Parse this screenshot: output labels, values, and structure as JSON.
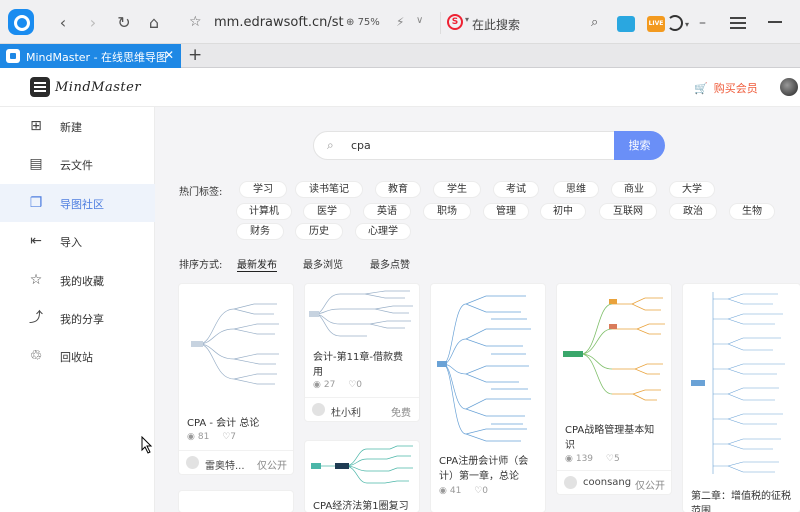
{
  "browser": {
    "url": "mm.edrawsoft.cn/st",
    "zoom": "75%",
    "search_placeholder": "在此搜索",
    "ext2_label": "LIVE"
  },
  "tab": {
    "title": "MindMaster - 在线思维导图"
  },
  "app": {
    "name": "MindMaster",
    "buy_label": "购买会员"
  },
  "sidebar": {
    "items": [
      {
        "label": "新建",
        "icon": "plus-square-icon"
      },
      {
        "label": "云文件",
        "icon": "cloud-file-icon"
      },
      {
        "label": "导图社区",
        "icon": "community-icon"
      },
      {
        "label": "导入",
        "icon": "import-icon"
      },
      {
        "label": "我的收藏",
        "icon": "star-icon"
      },
      {
        "label": "我的分享",
        "icon": "share-icon"
      },
      {
        "label": "回收站",
        "icon": "trash-icon"
      }
    ]
  },
  "search": {
    "query": "cpa",
    "button": "搜索"
  },
  "hot": {
    "label": "热门标签:",
    "tags": [
      "学习",
      "读书笔记",
      "教育",
      "学生",
      "考试",
      "思维",
      "商业",
      "大学",
      "计算机",
      "医学",
      "英语",
      "职场",
      "管理",
      "初中",
      "互联网",
      "政治",
      "生物",
      "财务",
      "历史",
      "心理学"
    ]
  },
  "sort": {
    "label": "排序方式:",
    "options": [
      "最新发布",
      "最多浏览",
      "最多点赞"
    ]
  },
  "cards": [
    {
      "title": "CPA - 会计 总论",
      "views": "81",
      "likes": "7",
      "author": "雷奥特...",
      "status": "仅公开"
    },
    {
      "title": "会计-第11章-借款费用",
      "views": "27",
      "likes": "0",
      "author": "杜小利",
      "status": "免费"
    },
    {
      "title": "CPA注册会计师（会计）第一章，总论",
      "views": "41",
      "likes": "0"
    },
    {
      "title": "CPA战略管理基本知识",
      "views": "139",
      "likes": "5",
      "author": "coonsang",
      "status": "仅公开"
    },
    {
      "title": "第二章：增值税的征税范围"
    },
    {
      "title": "CPA经济法第1圈复习"
    }
  ]
}
